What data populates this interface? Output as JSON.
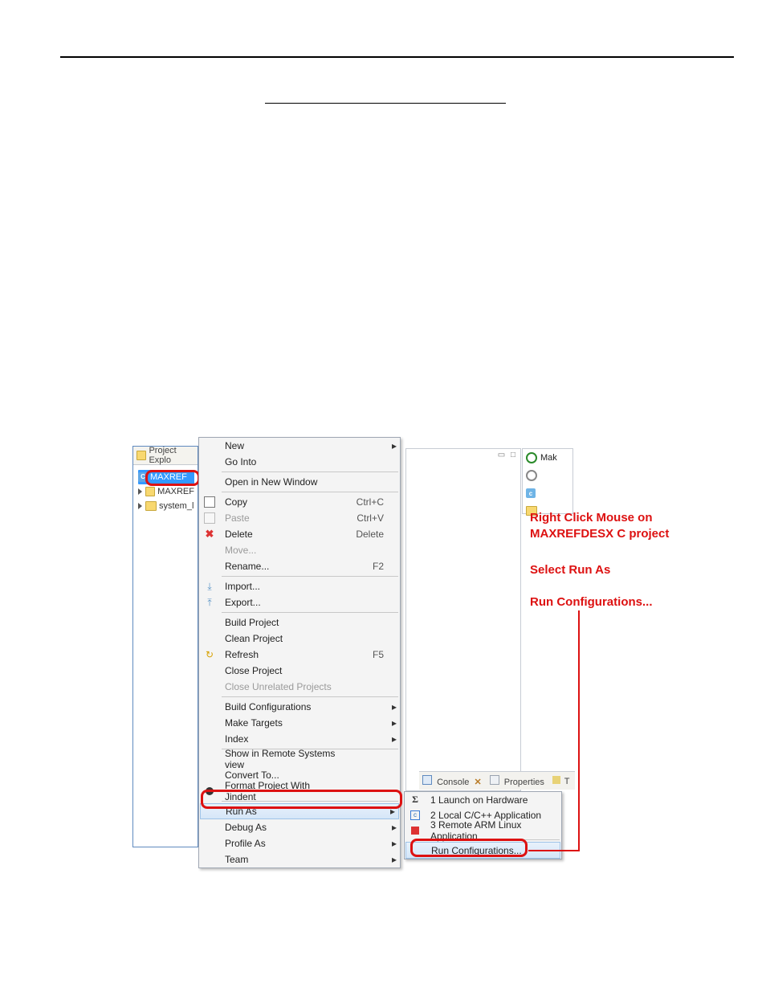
{
  "explorer": {
    "title": "Project Explo",
    "items": [
      {
        "label": "MAXREF"
      },
      {
        "label": "MAXREF"
      },
      {
        "label": "system_l"
      }
    ]
  },
  "menu": {
    "new": "New",
    "gointo": "Go Into",
    "opennew": "Open in New Window",
    "copy": "Copy",
    "copy_sc": "Ctrl+C",
    "paste": "Paste",
    "paste_sc": "Ctrl+V",
    "delete": "Delete",
    "delete_sc": "Delete",
    "move": "Move...",
    "rename": "Rename...",
    "rename_sc": "F2",
    "import": "Import...",
    "export": "Export...",
    "buildproj": "Build Project",
    "cleanproj": "Clean Project",
    "refresh": "Refresh",
    "refresh_sc": "F5",
    "closeproj": "Close Project",
    "closeunrel": "Close Unrelated Projects",
    "buildconf": "Build Configurations",
    "maketgt": "Make Targets",
    "index": "Index",
    "showremote": "Show in Remote Systems view",
    "convertto": "Convert To...",
    "formatjindent": "Format Project With Jindent",
    "runas": "Run As",
    "debugas": "Debug As",
    "profileas": "Profile As",
    "team": "Team"
  },
  "submenu": {
    "opt1": "1 Launch on Hardware",
    "opt2": "2 Local C/C++ Application",
    "opt3": "3 Remote ARM Linux Application",
    "runconf": "Run Configurations..."
  },
  "tabs": {
    "console": "Console",
    "properties": "Properties",
    "t": "T"
  },
  "rightpanel": {
    "mak": "Mak"
  },
  "annot": {
    "line1a": "Right Click Mouse on",
    "line1b": "MAXREFDESX C project",
    "line2": "Select Run As",
    "line3": "Run Configurations..."
  }
}
